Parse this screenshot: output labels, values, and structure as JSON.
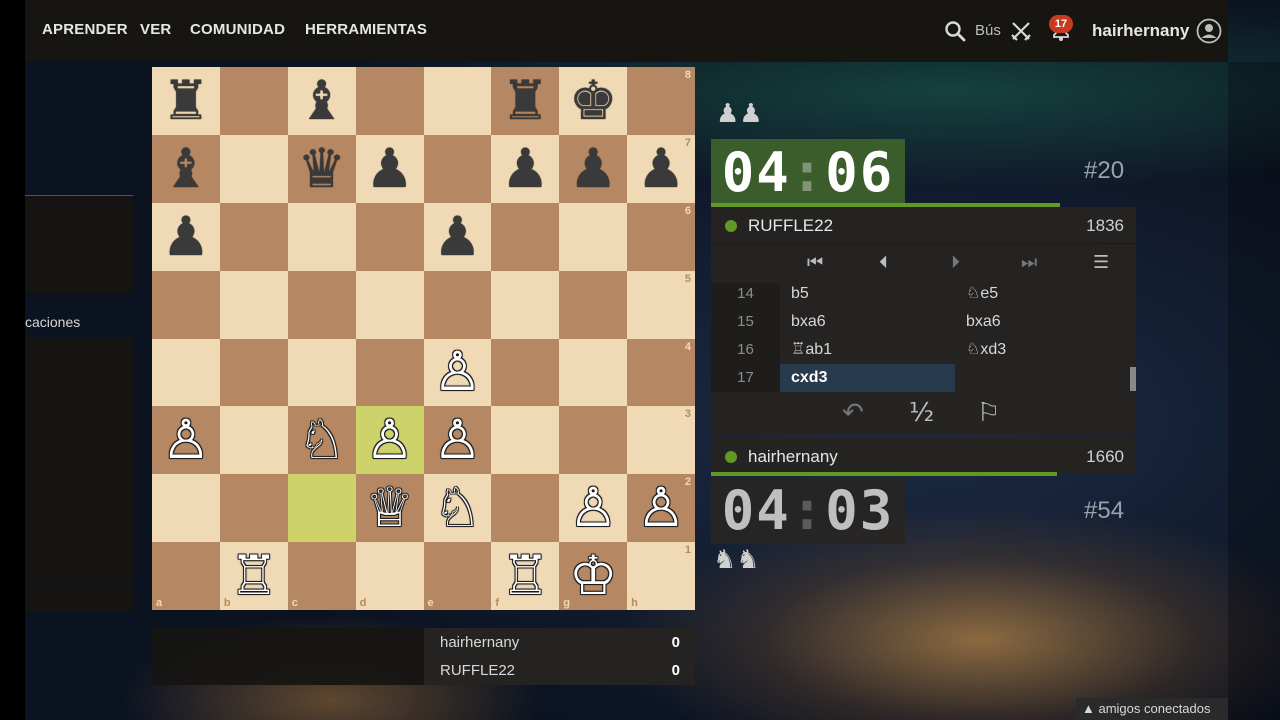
{
  "nav": {
    "items": [
      {
        "label": "APRENDER"
      },
      {
        "label": "VER"
      },
      {
        "label": "COMUNIDAD"
      },
      {
        "label": "HERRAMIENTAS"
      }
    ],
    "search_label": "Bús",
    "notifications_count": "17",
    "username": "hairhernany"
  },
  "sidebar": {
    "label": "caciones"
  },
  "board": {
    "files": [
      "a",
      "b",
      "c",
      "d",
      "e",
      "f",
      "g",
      "h"
    ],
    "ranks": [
      "8",
      "7",
      "6",
      "5",
      "4",
      "3",
      "2",
      "1"
    ],
    "rows": [
      [
        "♜",
        "",
        "♝",
        "",
        "",
        "♜",
        "♚",
        ""
      ],
      [
        "♝",
        "",
        "♛",
        "♟",
        "",
        "♟",
        "♟",
        "♟"
      ],
      [
        "♟",
        "",
        "",
        "",
        "♟",
        "",
        "",
        ""
      ],
      [
        "",
        "",
        "",
        "",
        "",
        "",
        "",
        ""
      ],
      [
        "",
        "",
        "",
        "",
        "♙",
        "",
        "",
        ""
      ],
      [
        "♙",
        "",
        "♘",
        "♙",
        "♙",
        "",
        "",
        ""
      ],
      [
        "",
        "",
        "",
        "♕",
        "♘",
        "",
        "♙",
        "♙"
      ],
      [
        "",
        "♖",
        "",
        "",
        "",
        "♖",
        "♔",
        ""
      ]
    ],
    "last_move": [
      "c2",
      "d3"
    ]
  },
  "scoreboard": {
    "rows": [
      {
        "name": "hairhernany",
        "score": "0"
      },
      {
        "name": "RUFFLE22",
        "score": "0"
      }
    ]
  },
  "opponent": {
    "captured": "♟♟",
    "clock": "04:06",
    "move_badge": "#20",
    "name": "RUFFLE22",
    "rating": "1836",
    "online_color": "#629924"
  },
  "player": {
    "captured": "♞♞",
    "clock": "04:03",
    "move_badge": "#54",
    "name": "hairhernany",
    "rating": "1660",
    "online_color": "#629924"
  },
  "move_list": [
    {
      "num": "14",
      "white": "b5",
      "black": "♘e5"
    },
    {
      "num": "15",
      "white": "bxa6",
      "black": "bxa6"
    },
    {
      "num": "16",
      "white": "♖ab1",
      "black": "♘xd3"
    },
    {
      "num": "17",
      "white": "cxd3",
      "black": ""
    }
  ],
  "controls": [
    "first-icon",
    "prev-icon",
    "next-icon",
    "last-icon",
    "menu-icon"
  ],
  "actions": {
    "takeback": "↶",
    "draw": "½",
    "resign": "⚐"
  },
  "friends_bar": "▲ amigos conectados",
  "colors": {
    "accent": "#629924",
    "board_light": "#f0d9b5",
    "board_dark": "#b58863",
    "last_move": "#cdd26a",
    "clock_active": "#3b5d2b"
  }
}
